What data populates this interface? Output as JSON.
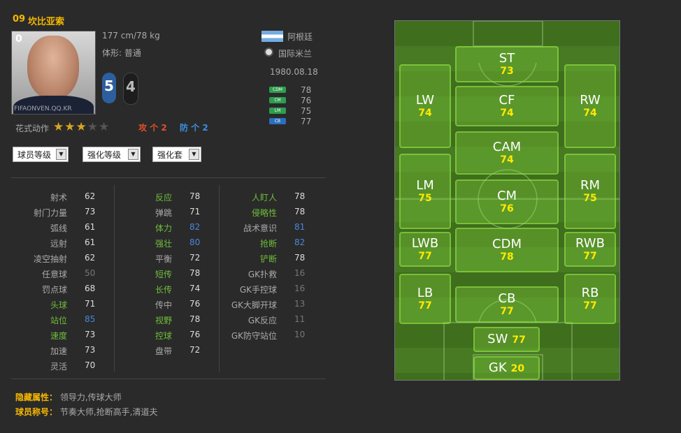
{
  "player": {
    "season": "09",
    "name": "坎比亚索",
    "grade": "0",
    "watermark": "FIFAONVEN.QQ.KR",
    "height_weight": "177 cm/78 kg",
    "body_type": "体形: 普通",
    "nationality": "阿根廷",
    "club": "国际米兰",
    "birthdate": "1980.08.18",
    "weak_foot": "5",
    "skill_badge": "4",
    "skill_moves_label": "花式动作",
    "skill_stars": 3,
    "skill_stars_max": 5,
    "attack_label": "攻",
    "attack_arrow": "个",
    "attack_value": "2",
    "defense_label": "防",
    "defense_arrow": "个",
    "defense_value": "2",
    "positions": [
      {
        "pos": "CDM",
        "rating": "78",
        "color": "#2e9e4f"
      },
      {
        "pos": "CM",
        "rating": "76",
        "color": "#2e9e4f"
      },
      {
        "pos": "LM",
        "rating": "75",
        "color": "#2e9e4f"
      },
      {
        "pos": "CB",
        "rating": "77",
        "color": "#2a6fc0"
      }
    ]
  },
  "controls": {
    "select1": "球员等级",
    "select2": "强化等级",
    "select3": "强化套"
  },
  "stats": {
    "col1": [
      {
        "name": "射术",
        "value": "62",
        "hl": false,
        "tone": ""
      },
      {
        "name": "射门力量",
        "value": "73",
        "hl": false,
        "tone": ""
      },
      {
        "name": "弧线",
        "value": "61",
        "hl": false,
        "tone": ""
      },
      {
        "name": "远射",
        "value": "61",
        "hl": false,
        "tone": ""
      },
      {
        "name": "凌空抽射",
        "value": "62",
        "hl": false,
        "tone": ""
      },
      {
        "name": "任意球",
        "value": "50",
        "hl": false,
        "tone": "dim"
      },
      {
        "name": "罚点球",
        "value": "68",
        "hl": false,
        "tone": ""
      },
      {
        "name": "头球",
        "value": "71",
        "hl": true,
        "tone": ""
      },
      {
        "name": "站位",
        "value": "85",
        "hl": true,
        "tone": "blue"
      },
      {
        "name": "速度",
        "value": "73",
        "hl": true,
        "tone": ""
      },
      {
        "name": "加速",
        "value": "73",
        "hl": false,
        "tone": ""
      },
      {
        "name": "灵活",
        "value": "70",
        "hl": false,
        "tone": ""
      }
    ],
    "col2": [
      {
        "name": "反应",
        "value": "78",
        "hl": true,
        "tone": ""
      },
      {
        "name": "弹跳",
        "value": "71",
        "hl": false,
        "tone": ""
      },
      {
        "name": "体力",
        "value": "82",
        "hl": true,
        "tone": "blue"
      },
      {
        "name": "强壮",
        "value": "80",
        "hl": true,
        "tone": "blue"
      },
      {
        "name": "平衡",
        "value": "72",
        "hl": false,
        "tone": ""
      },
      {
        "name": "短传",
        "value": "78",
        "hl": true,
        "tone": ""
      },
      {
        "name": "长传",
        "value": "74",
        "hl": true,
        "tone": ""
      },
      {
        "name": "传中",
        "value": "76",
        "hl": false,
        "tone": ""
      },
      {
        "name": "视野",
        "value": "78",
        "hl": true,
        "tone": ""
      },
      {
        "name": "控球",
        "value": "76",
        "hl": true,
        "tone": ""
      },
      {
        "name": "盘带",
        "value": "72",
        "hl": false,
        "tone": ""
      }
    ],
    "col3": [
      {
        "name": "人盯人",
        "value": "78",
        "hl": true,
        "tone": ""
      },
      {
        "name": "侵略性",
        "value": "78",
        "hl": true,
        "tone": ""
      },
      {
        "name": "战术意识",
        "value": "81",
        "hl": false,
        "tone": "blue"
      },
      {
        "name": "抢断",
        "value": "82",
        "hl": true,
        "tone": "blue"
      },
      {
        "name": "铲断",
        "value": "78",
        "hl": true,
        "tone": ""
      },
      {
        "name": "GK扑救",
        "value": "16",
        "hl": false,
        "tone": "dim"
      },
      {
        "name": "GK手控球",
        "value": "16",
        "hl": false,
        "tone": "dim"
      },
      {
        "name": "GK大脚开球",
        "value": "13",
        "hl": false,
        "tone": "dim"
      },
      {
        "name": "GK反应",
        "value": "11",
        "hl": false,
        "tone": "dim"
      },
      {
        "name": "GK防守站位",
        "value": "10",
        "hl": false,
        "tone": "dim"
      }
    ]
  },
  "footer": {
    "hidden_label": "隐藏属性：",
    "hidden_value": "领导力,传球大师",
    "title_label": "球员称号：",
    "title_value": "节奏大师,抢断高手,清道夫"
  },
  "pitch": [
    {
      "pos": "ST",
      "rating": "73"
    },
    {
      "pos": "CF",
      "rating": "74"
    },
    {
      "pos": "CAM",
      "rating": "74"
    },
    {
      "pos": "CM",
      "rating": "76"
    },
    {
      "pos": "CDM",
      "rating": "78"
    },
    {
      "pos": "CB",
      "rating": "77"
    },
    {
      "pos": "SW",
      "rating": "77"
    },
    {
      "pos": "GK",
      "rating": "20"
    },
    {
      "pos": "LW",
      "rating": "74"
    },
    {
      "pos": "LM",
      "rating": "75"
    },
    {
      "pos": "LWB",
      "rating": "77"
    },
    {
      "pos": "LB",
      "rating": "77"
    },
    {
      "pos": "RW",
      "rating": "74"
    },
    {
      "pos": "RM",
      "rating": "75"
    },
    {
      "pos": "RWB",
      "rating": "77"
    },
    {
      "pos": "RB",
      "rating": "77"
    }
  ]
}
